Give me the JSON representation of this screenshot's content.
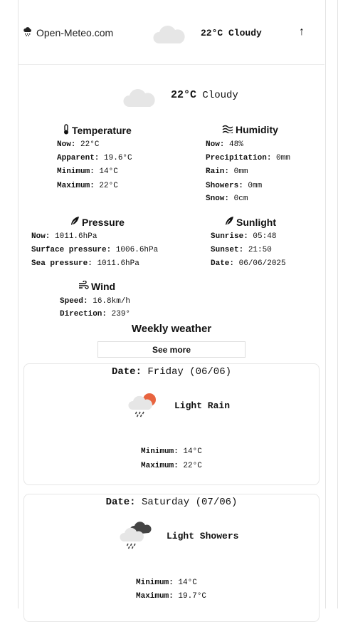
{
  "header": {
    "brand": "Open-Meteo.com",
    "summary": "22°C Cloudy",
    "arrow": "↑"
  },
  "current": {
    "temp": "22°C",
    "condition": "Cloudy"
  },
  "temperature": {
    "title": "Temperature",
    "now": {
      "label": "Now:",
      "value": "22°C"
    },
    "apparent": {
      "label": "Apparent:",
      "value": "19.6°C"
    },
    "minimum": {
      "label": "Minimum:",
      "value": "14°C"
    },
    "maximum": {
      "label": "Maximum:",
      "value": "22°C"
    }
  },
  "humidity": {
    "title": "Humidity",
    "now": {
      "label": "Now:",
      "value": "48%"
    },
    "precipitation": {
      "label": "Precipitation:",
      "value": "0mm"
    },
    "rain": {
      "label": "Rain:",
      "value": "0mm"
    },
    "showers": {
      "label": "Showers:",
      "value": "0mm"
    },
    "snow": {
      "label": "Snow:",
      "value": "0cm"
    }
  },
  "pressure": {
    "title": "Pressure",
    "now": {
      "label": "Now:",
      "value": "1011.6hPa"
    },
    "surface": {
      "label": "Surface pressure:",
      "value": "1006.6hPa"
    },
    "sea": {
      "label": "Sea pressure:",
      "value": "1011.6hPa"
    }
  },
  "sunlight": {
    "title": "Sunlight",
    "sunrise": {
      "label": "Sunrise:",
      "value": "05:48"
    },
    "sunset": {
      "label": "Sunset:",
      "value": "21:50"
    },
    "date": {
      "label": "Date:",
      "value": "06/06/2025"
    }
  },
  "wind": {
    "title": "Wind",
    "speed": {
      "label": "Speed:",
      "value": "16.8km/h"
    },
    "direction": {
      "label": "Direction:",
      "value": "239°"
    }
  },
  "weekly": {
    "title": "Weekly weather",
    "see_more": "See more",
    "days": [
      {
        "date_label": "Date:",
        "date": "Friday (06/06)",
        "condition": "Light Rain",
        "min_label": "Minimum:",
        "min": "14°C",
        "max_label": "Maximum:",
        "max": "22°C"
      },
      {
        "date_label": "Date:",
        "date": "Saturday (07/06)",
        "condition": "Light Showers",
        "min_label": "Minimum:",
        "min": "14°C",
        "max_label": "Maximum:",
        "max": "19.7°C"
      }
    ]
  }
}
